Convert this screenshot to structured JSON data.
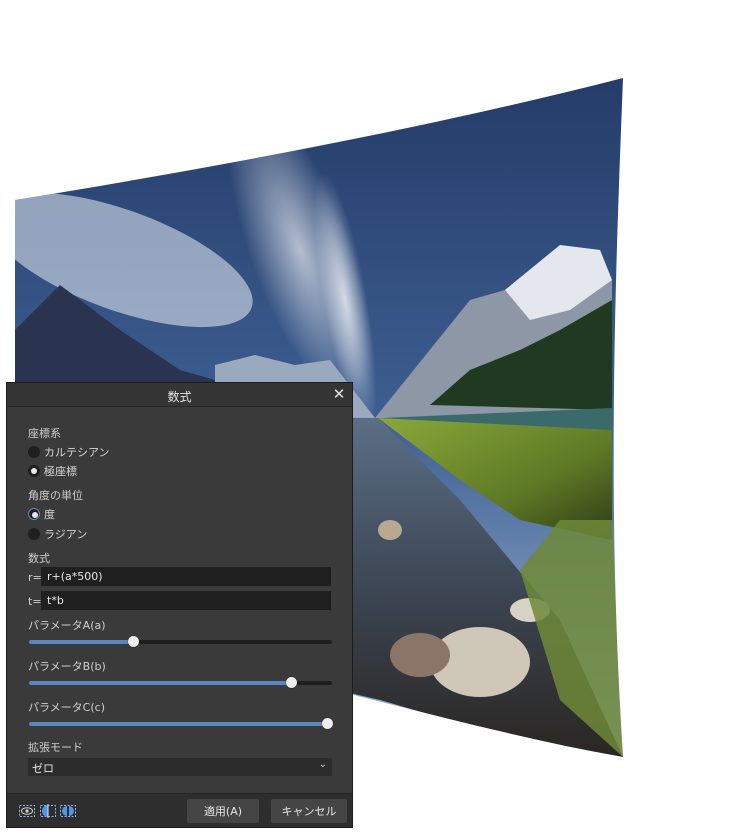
{
  "dialog": {
    "title": "数式",
    "close_glyph": "✕",
    "coordinate_system": {
      "label": "座標系",
      "options": [
        {
          "label": "カルテシアン",
          "selected": false
        },
        {
          "label": "極座標",
          "selected": true
        }
      ]
    },
    "angle_unit": {
      "label": "角度の単位",
      "options": [
        {
          "label": "度",
          "selected": true
        },
        {
          "label": "ラジアン",
          "selected": false
        }
      ]
    },
    "formula": {
      "label": "数式",
      "r_prefix": "r=",
      "r_value": "r+(a*500)",
      "t_prefix": "t=",
      "t_value": "t*b"
    },
    "params": [
      {
        "label": "パラメータA(a)",
        "value": 0.35
      },
      {
        "label": "パラメータB(b)",
        "value": 0.88
      },
      {
        "label": "パラメータC(c)",
        "value": 1.0
      }
    ],
    "extend_mode": {
      "label": "拡張モード",
      "value": "ゼロ",
      "chevron": "⌄"
    },
    "footer": {
      "icons": [
        "preview-eye-icon",
        "split-view-icon",
        "mirror-view-icon"
      ],
      "apply_label": "適用(A)",
      "cancel_label": "キャンセル"
    }
  },
  "colors": {
    "dialog_bg": "#3a3a3a",
    "accent": "#5a86bd"
  }
}
